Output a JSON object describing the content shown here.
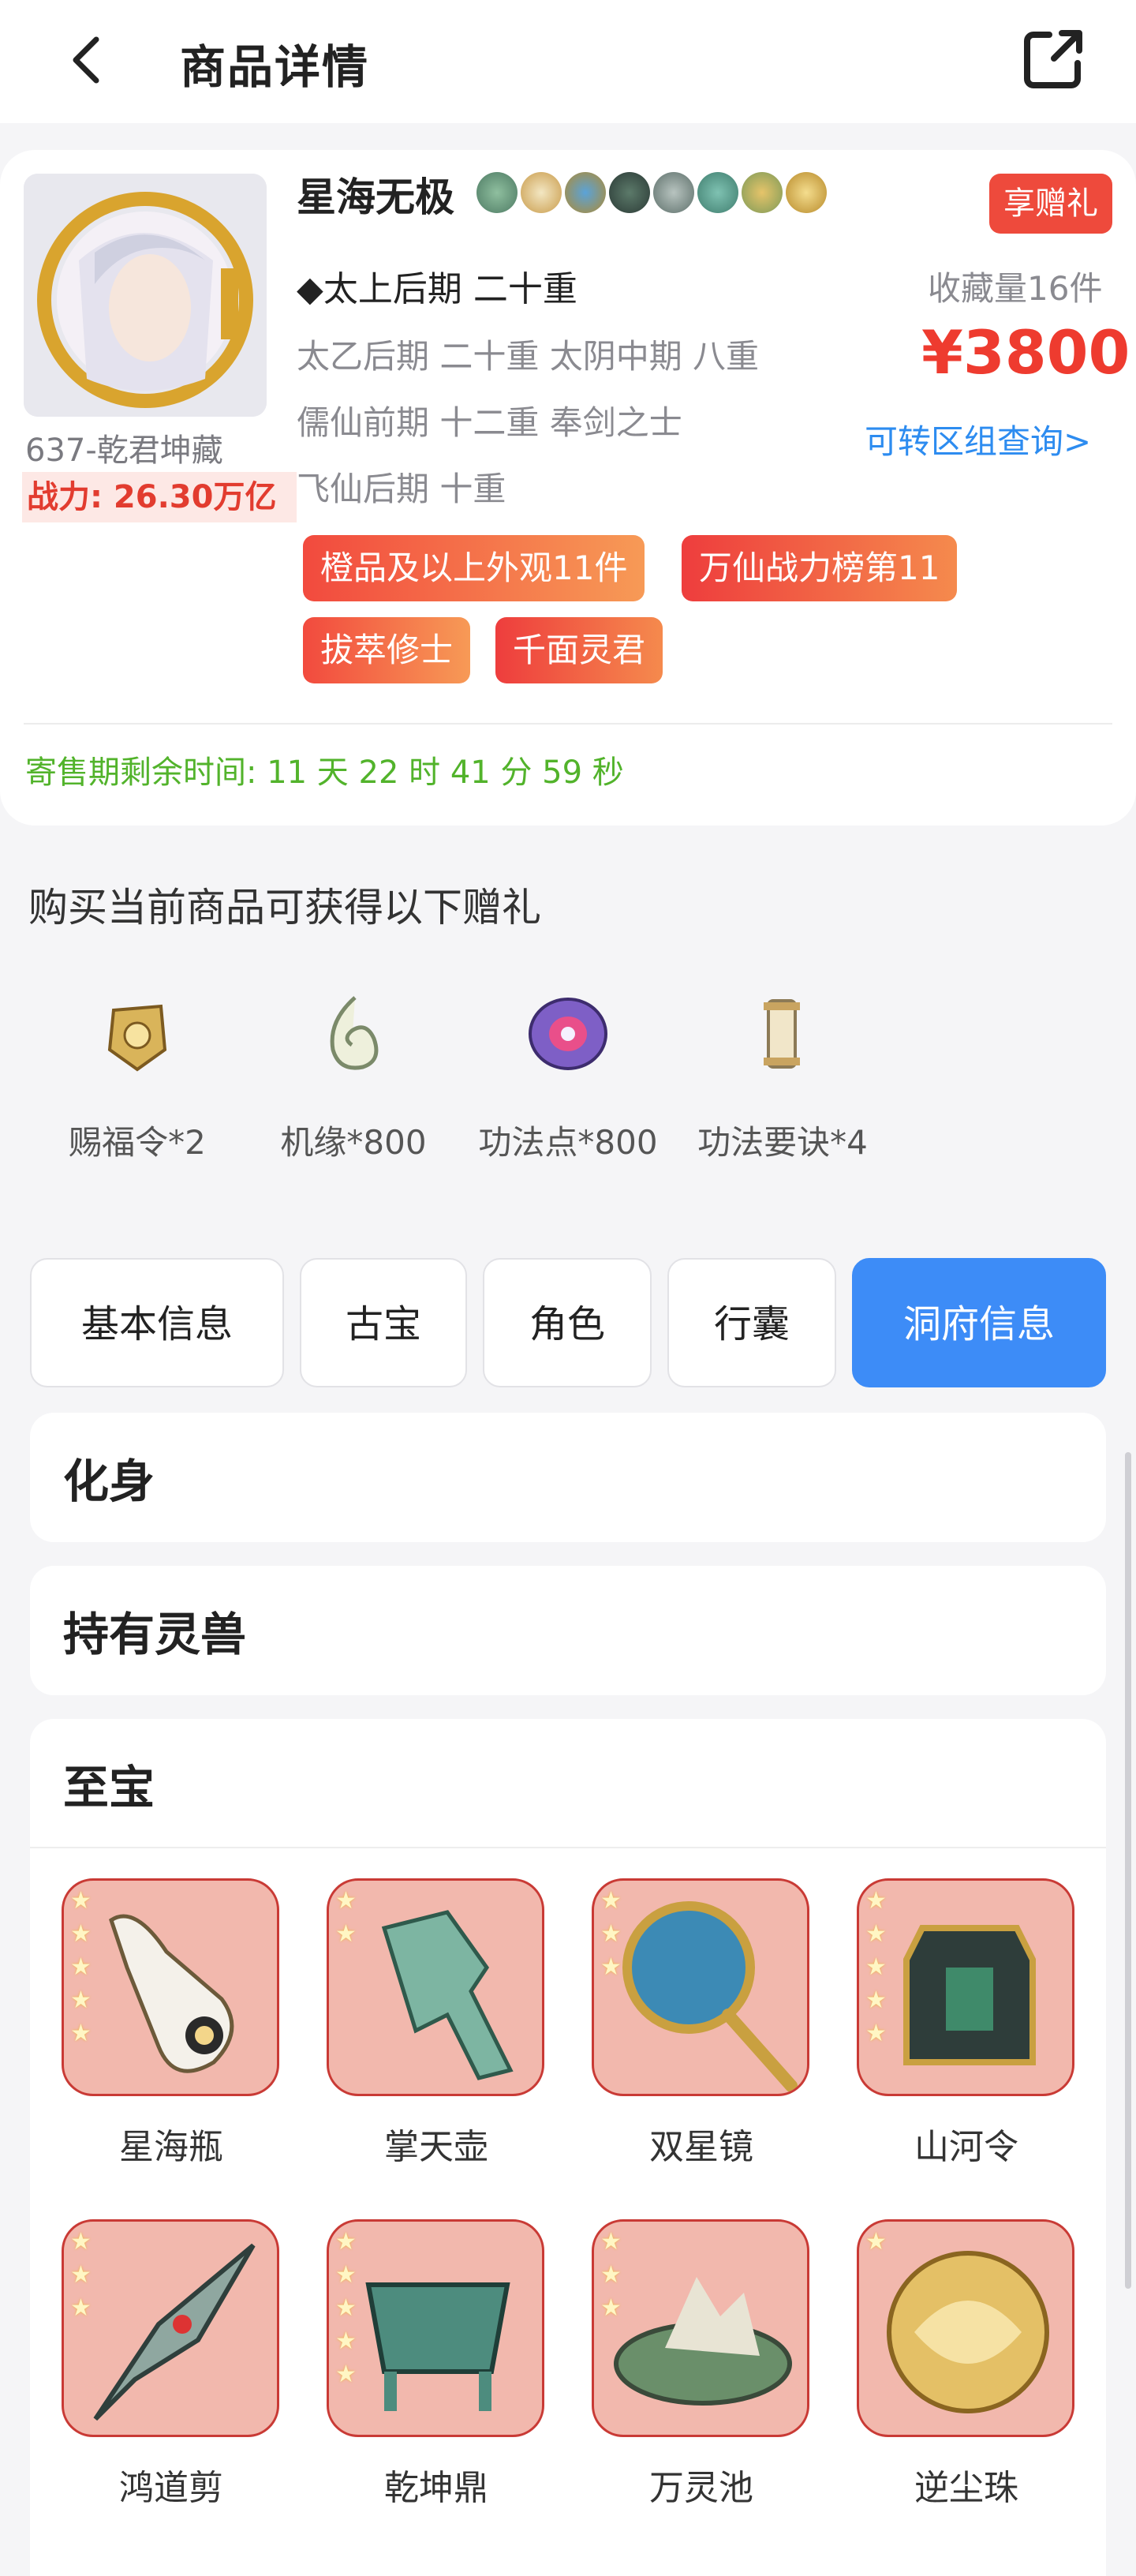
{
  "header": {
    "title": "商品详情",
    "back_icon": "back-arrow-icon",
    "share_icon": "share-icon"
  },
  "product": {
    "server": "637-乾君坤藏",
    "power_label": "战力: 26.30万亿",
    "name": "星海无极",
    "gift_badge": "享赠礼",
    "realm_main": "◆太上后期 二十重",
    "realm_lines": [
      "太乙后期 二十重  太阴中期 八重",
      "儒仙前期 十二重  奉剑之士",
      "飞仙后期 十重"
    ],
    "favorites": "收藏量16件",
    "price": "¥3800",
    "transfer_link": "可转区组查询>",
    "tags": [
      "橙品及以上外观11件",
      "万仙战力榜第11",
      "拔萃修士",
      "千面灵君"
    ],
    "timer": "寄售期剩余时间:  11 天 22 时 41 分 59 秒"
  },
  "gifts": {
    "title": "购买当前商品可获得以下赠礼",
    "items": [
      {
        "label": "赐福令*2",
        "icon": "blessing-token-icon"
      },
      {
        "label": "机缘*800",
        "icon": "fortune-jade-icon"
      },
      {
        "label": "功法点*800",
        "icon": "skill-point-icon"
      },
      {
        "label": "功法要诀*4",
        "icon": "skill-scroll-icon"
      }
    ]
  },
  "tabs": [
    {
      "label": "基本信息",
      "active": false
    },
    {
      "label": "古宝",
      "active": false
    },
    {
      "label": "角色",
      "active": false
    },
    {
      "label": "行囊",
      "active": false
    },
    {
      "label": "洞府信息",
      "active": true
    }
  ],
  "sections": {
    "avatar": "化身",
    "pets": "持有灵兽",
    "treasures": "至宝"
  },
  "treasures": [
    {
      "name": "星海瓶",
      "stars": 5
    },
    {
      "name": "掌天壶",
      "stars": 2
    },
    {
      "name": "双星镜",
      "stars": 3
    },
    {
      "name": "山河令",
      "stars": 5
    },
    {
      "name": "鸿道剪",
      "stars": 3
    },
    {
      "name": "乾坤鼎",
      "stars": 5
    },
    {
      "name": "万灵池",
      "stars": 3
    },
    {
      "name": "逆尘珠",
      "stars": 1
    }
  ],
  "colors": {
    "accent_blue": "#3d8cf7",
    "price_red": "#ee3b2f",
    "timer_green": "#52b32b",
    "treasure_bg": "#f2b8ad"
  }
}
